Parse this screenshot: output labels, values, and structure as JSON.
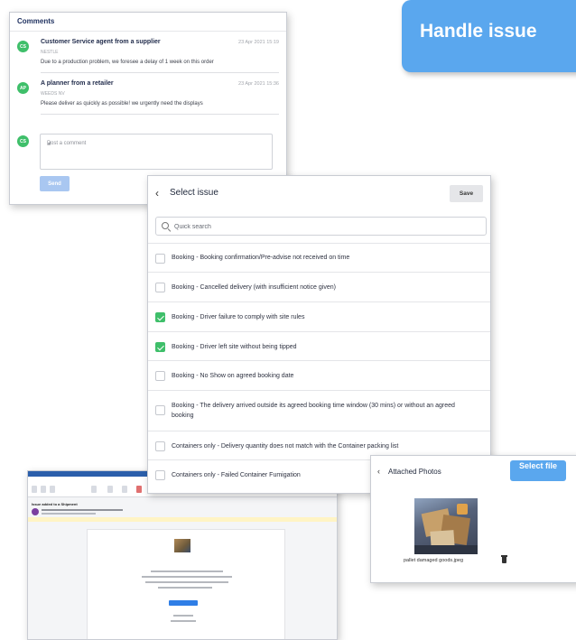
{
  "comments": {
    "title": "Comments",
    "items": [
      {
        "avatar": "CS",
        "author": "Customer Service agent from a supplier",
        "company": "NESTLE",
        "timestamp": "23 Apr 2021 15:19",
        "message": "Due to a production problem, we foresee a delay of 1 week on this order"
      },
      {
        "avatar": "AP",
        "author": "A planner from a retailer",
        "company": "WEEDS NV",
        "timestamp": "23 Apr 2021 15:36",
        "message": "Please deliver as quickly as possible! we urgently need the displays"
      }
    ],
    "current_user_avatar": "CS",
    "post_placeholder": "Post a comment",
    "send_label": "Send"
  },
  "banner": {
    "text": "Handle issue"
  },
  "email": {
    "subject": "Issue added to a Shipment"
  },
  "select_issue": {
    "title": "Select issue",
    "save_label": "Save",
    "search_placeholder": "Quick search",
    "options": [
      {
        "label": "Booking - Booking confirmation/Pre-advise not received on time",
        "checked": false
      },
      {
        "label": "Booking - Cancelled delivery (with insufficient notice given)",
        "checked": false
      },
      {
        "label": "Booking - Driver failure to comply with site rules",
        "checked": true
      },
      {
        "label": "Booking - Driver left site without being tipped",
        "checked": true
      },
      {
        "label": "Booking - No Show on agreed booking date",
        "checked": false
      },
      {
        "label": "Booking - The delivery arrived outside its agreed booking time window (30 mins) or without an agreed booking",
        "checked": false
      },
      {
        "label": "Containers only - Delivery quantity does not match with the Container packing list",
        "checked": false
      },
      {
        "label": "Containers only - Failed Container Fumigation",
        "checked": false
      }
    ]
  },
  "attached_photos": {
    "title": "Attached Photos",
    "select_file_label": "Select file",
    "file_name": "pallet damaged goods.jpeg"
  },
  "colors": {
    "accent": "#5aa7ee",
    "checkbox_checked": "#3fbf6a",
    "send_disabled": "#a9c7f1"
  }
}
